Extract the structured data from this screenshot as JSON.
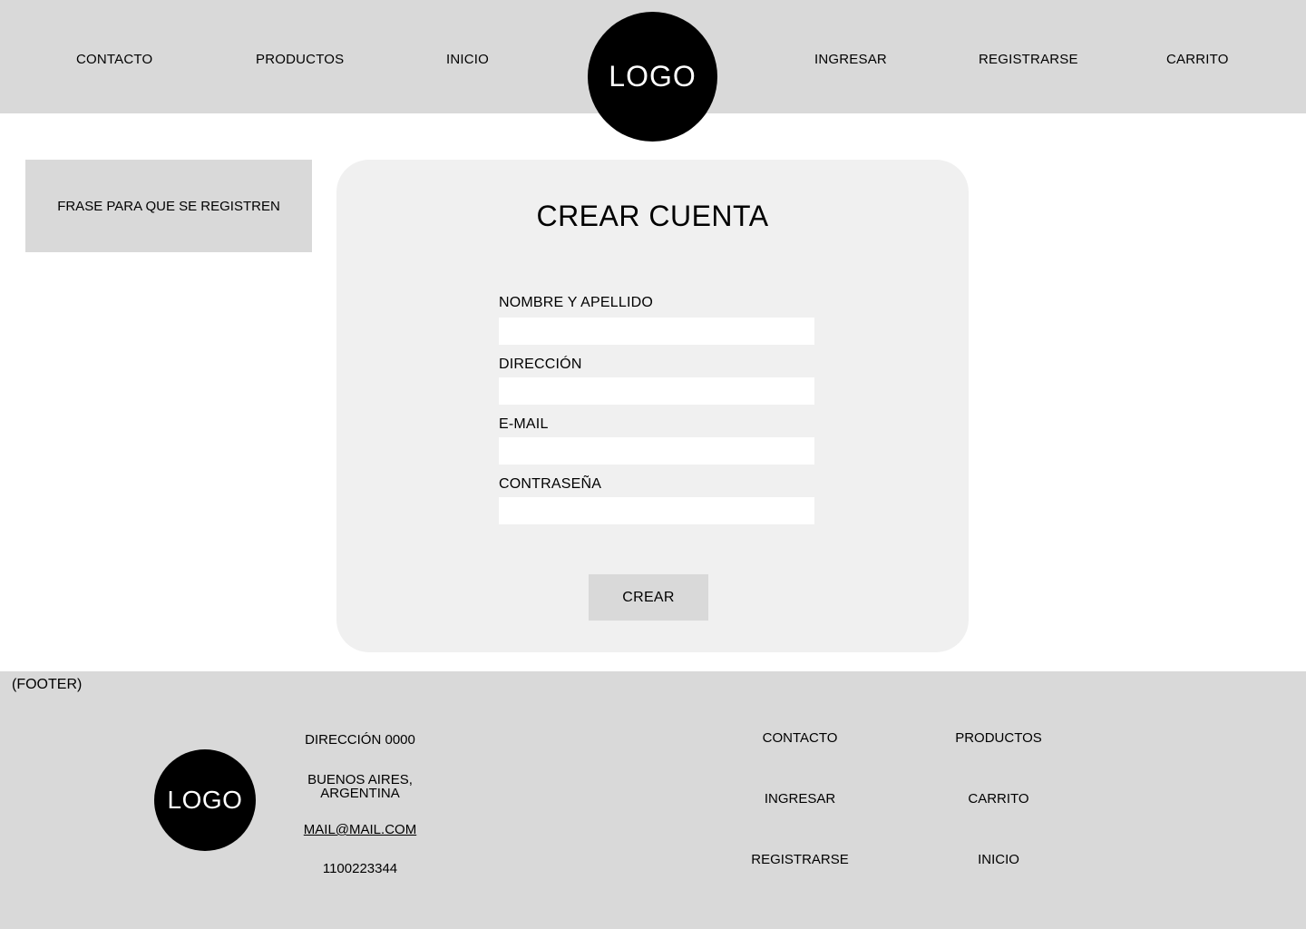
{
  "header": {
    "nav_left": [
      "CONTACTO",
      "PRODUCTOS",
      "INICIO"
    ],
    "logo": "LOGO",
    "nav_right": [
      "INGRESAR",
      "REGISTRARSE",
      "CARRITO"
    ]
  },
  "sidebar": {
    "phrase": "FRASE PARA QUE SE REGISTREN"
  },
  "form": {
    "title": "CREAR CUENTA",
    "fields": [
      {
        "label": "NOMBRE Y APELLIDO",
        "value": ""
      },
      {
        "label": "DIRECCIÓN",
        "value": ""
      },
      {
        "label": "E-MAIL",
        "value": ""
      },
      {
        "label": "CONTRASEÑA",
        "value": ""
      }
    ],
    "submit_label": "CREAR"
  },
  "footer": {
    "tag": "(FOOTER)",
    "logo": "LOGO",
    "address": "DIRECCIÓN 0000",
    "city_line1": "BUENOS AIRES,",
    "city_line2": "ARGENTINA",
    "email": "MAIL@MAIL.COM",
    "phone": "1100223344",
    "links": [
      "CONTACTO",
      "PRODUCTOS",
      "INGRESAR",
      "CARRITO",
      "REGISTRARSE",
      "INICIO"
    ]
  },
  "colors": {
    "header_bg": "#d9d9d9",
    "card_bg": "#f0f0f0",
    "logo_bg": "#000000"
  }
}
